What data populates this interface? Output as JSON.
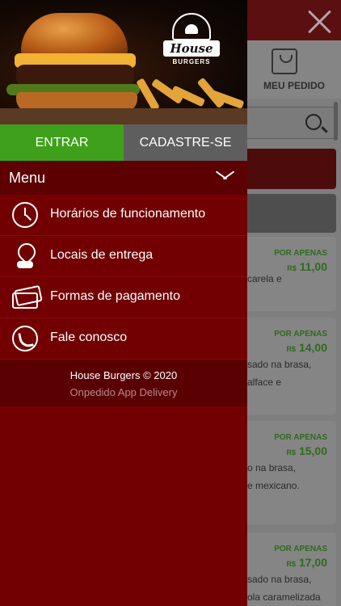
{
  "background": {
    "my_order_label": "MEU PEDIDO",
    "products": [
      {
        "per_label": "POR APENAS",
        "currency": "R$",
        "price": "11,00",
        "lines": [
          "carela e"
        ]
      },
      {
        "per_label": "POR APENAS",
        "currency": "R$",
        "price": "14,00",
        "lines": [
          "sado na brasa,",
          "alface e"
        ]
      },
      {
        "per_label": "POR APENAS",
        "currency": "R$",
        "price": "15,00",
        "lines": [
          "o na brasa,",
          "e mexicano."
        ]
      },
      {
        "per_label": "POR APENAS",
        "currency": "R$",
        "price": "17,00",
        "lines": [
          "sado na brasa,",
          "ola caramelizada"
        ]
      }
    ]
  },
  "drawer": {
    "logo": {
      "name": "House",
      "sub": "BURGERS"
    },
    "auth": {
      "login_label": "ENTRAR",
      "register_label": "CADASTRE-SE"
    },
    "menu": {
      "title": "Menu",
      "items": [
        {
          "icon": "clock-icon",
          "label": "Horários de funcionamento"
        },
        {
          "icon": "delivery-pin-icon",
          "label": "Locais de entrega"
        },
        {
          "icon": "payment-cards-icon",
          "label": "Formas de pagamento"
        },
        {
          "icon": "phone-icon",
          "label": "Fale conosco"
        }
      ]
    },
    "footer": {
      "copyright": "House Burgers © 2020",
      "powered_by": "Onpedido App Delivery"
    }
  },
  "colors": {
    "drawer_red": "#720002",
    "login_green": "#3fa11b",
    "register_gray": "#5e5e5e",
    "price_green": "#2f6a1e"
  }
}
